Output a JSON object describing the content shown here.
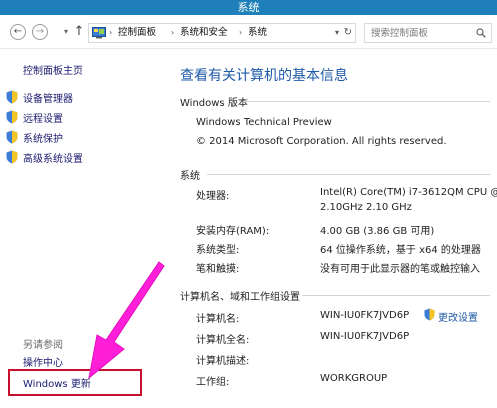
{
  "window": {
    "title": "系统"
  },
  "nav": {
    "back_glyph": "←",
    "forward_glyph": "→",
    "up_glyph": "↑",
    "dropdown_glyph": "▾",
    "breadcrumb": [
      "控制面板",
      "系统和安全",
      "系统"
    ],
    "separator": "›",
    "refresh_glyph": "↻",
    "search_placeholder": "搜索控制面板"
  },
  "sidebar": {
    "home": "控制面板主页",
    "items": [
      {
        "label": "设备管理器",
        "icon": "shield-icon"
      },
      {
        "label": "远程设置",
        "icon": "shield-icon"
      },
      {
        "label": "系统保护",
        "icon": "shield-icon"
      },
      {
        "label": "高级系统设置",
        "icon": "shield-icon"
      }
    ],
    "see_also": "另请参阅",
    "links": [
      "操作中心",
      "Windows 更新"
    ]
  },
  "main": {
    "title": "查看有关计算机的基本信息",
    "edition": {
      "heading": "Windows 版本",
      "name": "Windows Technical Preview",
      "copyright": "© 2014 Microsoft Corporation. All rights reserved."
    },
    "system": {
      "heading": "系统",
      "processor_label": "处理器:",
      "processor_line1": "Intel(R) Core(TM) i7-3612QM CPU @",
      "processor_line2": "2.10GHz   2.10 GHz",
      "ram_label": "安装内存(RAM):",
      "ram_value": "4.00 GB (3.86 GB 可用)",
      "type_label": "系统类型:",
      "type_value": "64 位操作系统，基于 x64 的处理器",
      "pen_label": "笔和触摸:",
      "pen_value": "没有可用于此显示器的笔或触控输入"
    },
    "computer": {
      "heading": "计算机名、域和工作组设置",
      "name_label": "计算机名:",
      "name_value": "WIN-IU0FK7JVD6P",
      "fullname_label": "计算机全名:",
      "fullname_value": "WIN-IU0FK7JVD6P",
      "desc_label": "计算机描述:",
      "desc_value": "",
      "workgroup_label": "工作组:",
      "workgroup_value": "WORKGROUP",
      "change_label": "更改设置"
    }
  },
  "colors": {
    "titlebar": "#1f7fb8",
    "link": "#1e5aa8",
    "sidebar_link": "#1a1a6e",
    "annotation_arrow": "#ff1fd8",
    "annotation_box": "#c8102e"
  }
}
